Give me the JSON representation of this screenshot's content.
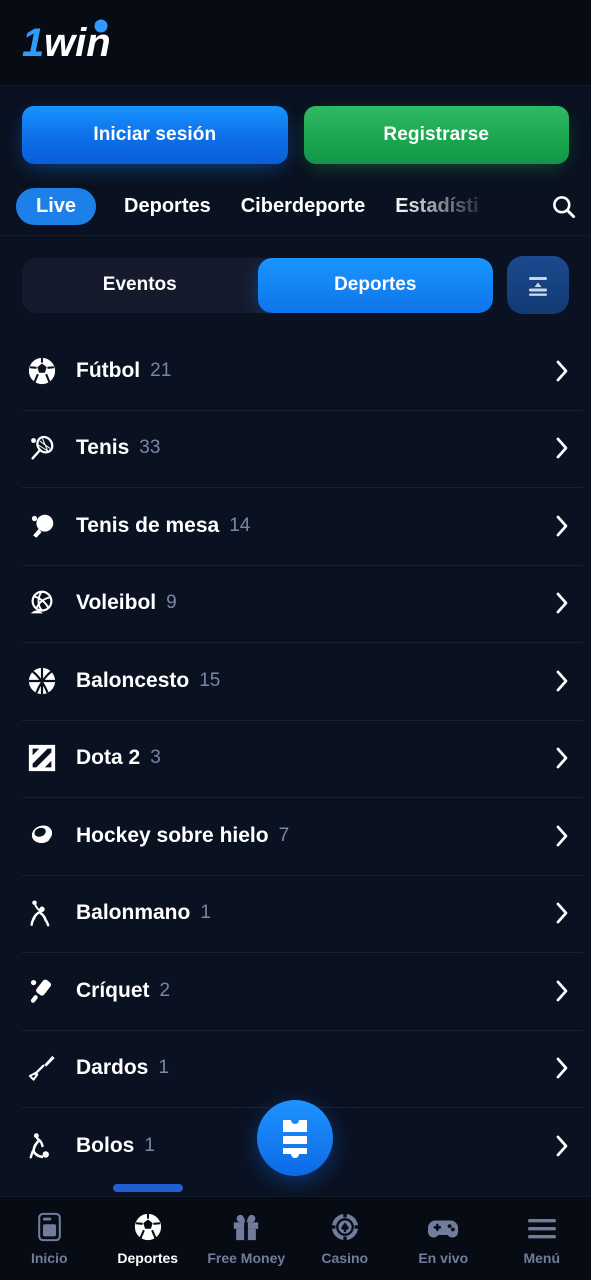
{
  "brand": {
    "name": "1win",
    "part1": "1",
    "part2": "win",
    "accent": "#1a8cff"
  },
  "auth": {
    "login_label": "Iniciar sesión",
    "register_label": "Registrarse",
    "login_color": "#0d6fe8",
    "register_color": "#18a14c"
  },
  "top_tabs": {
    "items": [
      {
        "label": "Live",
        "active": true
      },
      {
        "label": "Deportes",
        "active": false
      },
      {
        "label": "Ciberdeporte",
        "active": false
      },
      {
        "label": "Estadísti",
        "active": false
      }
    ],
    "search_icon": "search-icon"
  },
  "segment": {
    "events_label": "Eventos",
    "sports_label": "Deportes",
    "active": "Deportes",
    "filter_icon": "sort-filter-icon"
  },
  "sports": [
    {
      "name": "Fútbol",
      "count": "21",
      "icon": "soccer-ball-icon"
    },
    {
      "name": "Tenis",
      "count": "33",
      "icon": "tennis-racket-icon"
    },
    {
      "name": "Tenis de mesa",
      "count": "14",
      "icon": "table-tennis-icon"
    },
    {
      "name": "Voleibol",
      "count": "9",
      "icon": "volleyball-icon"
    },
    {
      "name": "Baloncesto",
      "count": "15",
      "icon": "basketball-icon"
    },
    {
      "name": "Dota 2",
      "count": "3",
      "icon": "dota2-icon"
    },
    {
      "name": "Hockey sobre hielo",
      "count": "7",
      "icon": "ice-hockey-puck-icon"
    },
    {
      "name": "Balonmano",
      "count": "1",
      "icon": "handball-player-icon"
    },
    {
      "name": "Críquet",
      "count": "2",
      "icon": "cricket-bat-icon"
    },
    {
      "name": "Dardos",
      "count": "1",
      "icon": "dart-icon"
    },
    {
      "name": "Bolos",
      "count": "1",
      "icon": "bowling-player-icon"
    }
  ],
  "betslip": {
    "icon": "bet-slip-ticket-icon"
  },
  "bottom_nav": {
    "items": [
      {
        "label": "Inicio",
        "icon": "phone-home-icon",
        "active": false
      },
      {
        "label": "Deportes",
        "icon": "soccer-ball-icon",
        "active": true
      },
      {
        "label": "Free Money",
        "icon": "gift-icon",
        "active": false
      },
      {
        "label": "Casino",
        "icon": "casino-chip-icon",
        "active": false
      },
      {
        "label": "En vivo",
        "icon": "gamepad-icon",
        "active": false
      },
      {
        "label": "Menú",
        "icon": "hamburger-icon",
        "active": false
      }
    ]
  }
}
